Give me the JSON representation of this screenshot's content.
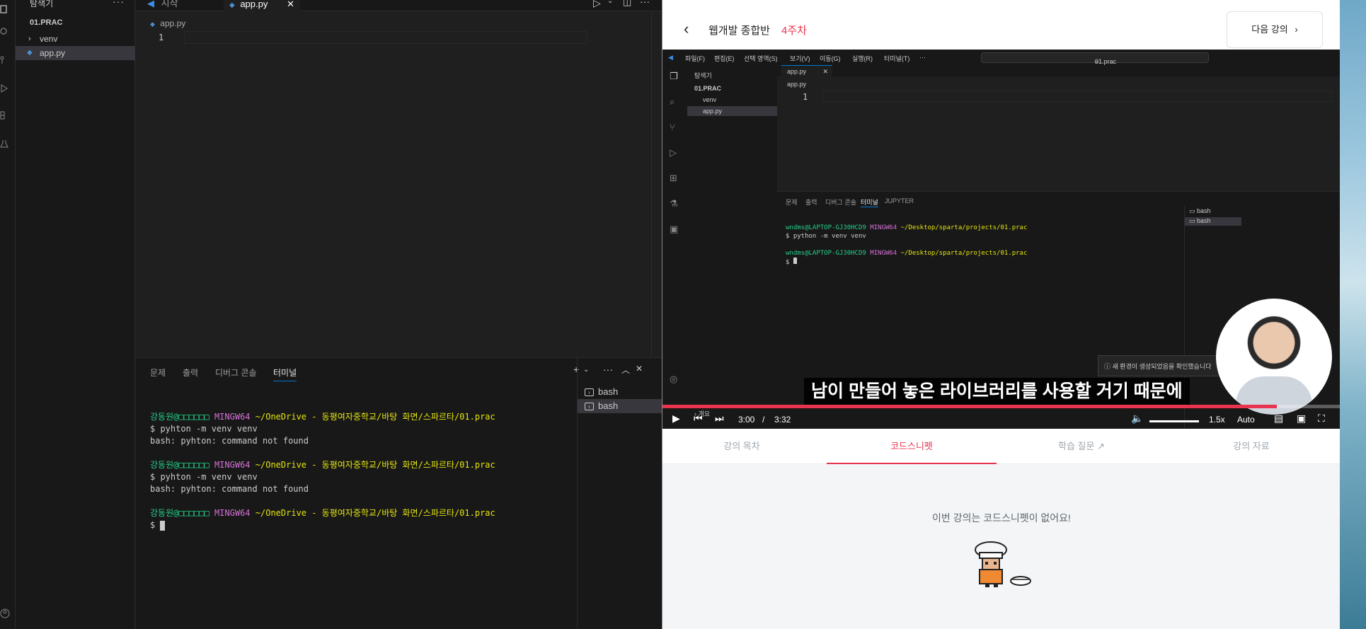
{
  "left_editor": {
    "sidebar_title": "탐색기",
    "sidebar_more": "···",
    "tree_root": "01.PRAC",
    "tree_items": [
      "venv",
      "app.py"
    ],
    "tabs": [
      "시작",
      "app.py"
    ],
    "breadcrumb": "app.py",
    "line_number": "1",
    "panel_tabs": [
      "문제",
      "출력",
      "디버그 콘솔",
      "터미널"
    ],
    "terminal_lines": [
      {
        "user": "강동원@",
        "host": "□□□□□□",
        "shell": "MINGW64",
        "path": "~/OneDrive - 동평여자중학교/바탕 화면/스파르타/01.prac"
      },
      {
        "text": "$ pyhton -m venv venv"
      },
      {
        "text": "bash: pyhton: command not found"
      },
      {
        "user": "강동원@",
        "host": "□□□□□□",
        "shell": "MINGW64",
        "path": "~/OneDrive - 동평여자중학교/바탕 화면/스파르타/01.prac"
      },
      {
        "text": "$ pyhton -m venv venv"
      },
      {
        "text": "bash: pyhton: command not found"
      },
      {
        "user": "강동원@",
        "host": "□□□□□□",
        "shell": "MINGW64",
        "path": "~/OneDrive - 동평여자중학교/바탕 화면/스파르타/01.prac"
      },
      {
        "text": "$ "
      }
    ],
    "terminal_instances": [
      "bash",
      "bash"
    ]
  },
  "lecture": {
    "title": "웹개발 종합반",
    "week": "4주차",
    "next_button": "다음 강의",
    "video": {
      "menu": [
        "파일(F)",
        "편집(E)",
        "선택 영역(S)",
        "보기(V)",
        "이동(G)",
        "실행(R)",
        "터미널(T)",
        "···"
      ],
      "search": "01.prac",
      "sidebar_title": "탐색기",
      "tree_root": "01.PRAC",
      "tree_items": [
        "venv",
        "app.py"
      ],
      "tab": "app.py",
      "breadcrumb": "app.py",
      "line_number": "1",
      "panel_tabs": [
        "문제",
        "출력",
        "디버그 콘솔",
        "터미널",
        "JUPYTER"
      ],
      "terminal_lines": [
        {
          "user": "wndms@LAPTOP-GJ30HCD9",
          "shell": "MINGW64",
          "path": "~/Desktop/sparta/projects/01.prac"
        },
        {
          "text": "$ python -m venv venv"
        },
        {
          "user": "wndms@LAPTOP-GJ30HCD9",
          "shell": "MINGW64",
          "path": "~/Desktop/sparta/projects/01.prac"
        },
        {
          "text": "$ "
        }
      ],
      "terminal_instances": [
        "bash",
        "bash"
      ],
      "outline_label": "개요",
      "notification": "새 환경이 생성되었음을 확인했습니다",
      "subtitle": "남이 만들어 놓은 라이브러리를 사용할 거기 때문에",
      "current_time": "3:00",
      "separator": "/",
      "duration": "3:32",
      "progress": 0.906,
      "speed": "1.5x",
      "quality": "Auto"
    },
    "tabs": [
      "강의 목차",
      "코드스니펫",
      "학습 질문",
      "강의 자료"
    ],
    "active_tab": "코드스니펫",
    "empty_message": "이번 강의는 코드스니펫이 없어요!",
    "accent_color": "#e8344e"
  }
}
